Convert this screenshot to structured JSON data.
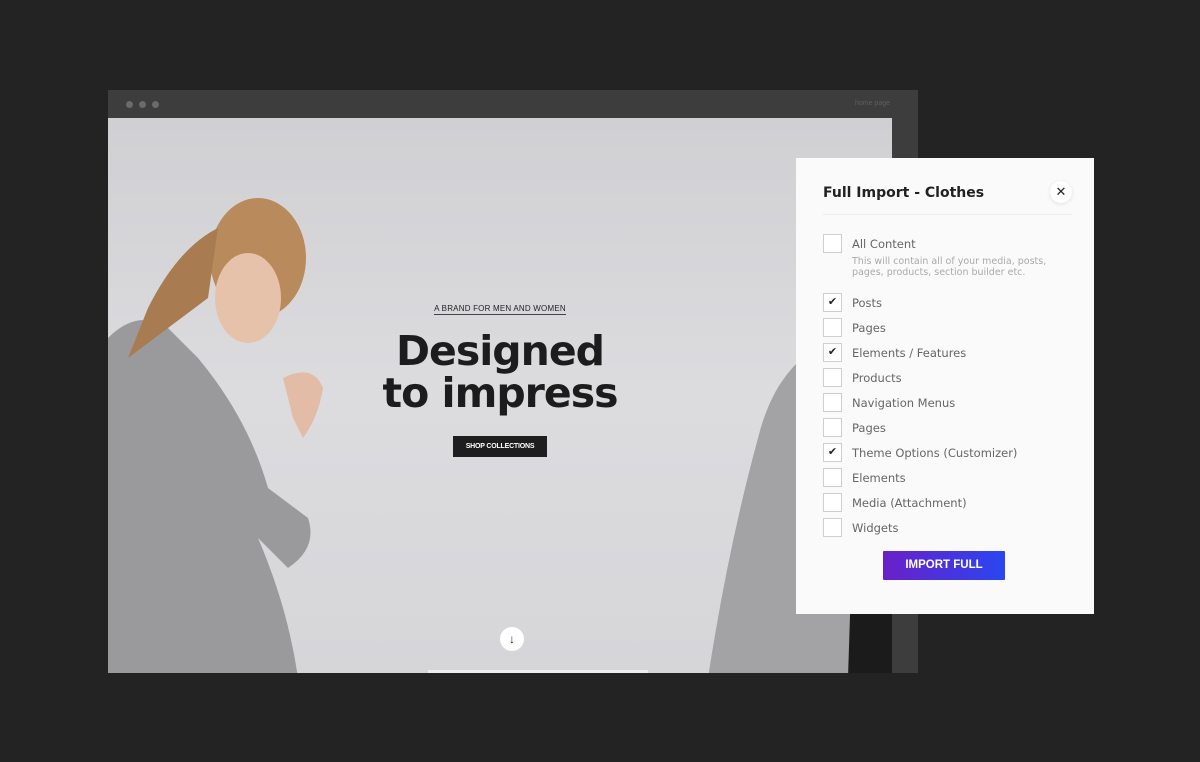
{
  "browser": {
    "url_label": "home page"
  },
  "site": {
    "tagline": "A BRAND FOR MEN AND WOMEN",
    "headline_1": "Designed",
    "headline_2": "to impress",
    "cta": "SHOP COLLECTIONS",
    "scroll_icon": "arrow-down-icon"
  },
  "dialog": {
    "title": "Full Import - Clothes",
    "close_icon": "close-icon",
    "all_content": {
      "label": "All Content",
      "description": "This will contain all of your media, posts, pages, products, section builder etc.",
      "checked": false
    },
    "options": [
      {
        "label": "Posts",
        "checked": true
      },
      {
        "label": "Pages",
        "checked": false
      },
      {
        "label": "Elements / Features",
        "checked": true
      },
      {
        "label": "Products",
        "checked": false
      },
      {
        "label": "Navigation Menus",
        "checked": false
      },
      {
        "label": "Pages",
        "checked": false
      },
      {
        "label": "Theme Options (Customizer)",
        "checked": true
      },
      {
        "label": "Elements",
        "checked": false
      },
      {
        "label": "Media (Attachment)",
        "checked": false
      },
      {
        "label": "Widgets",
        "checked": false
      }
    ],
    "import_button": "IMPORT FULL"
  },
  "colors": {
    "button_start": "#6a20c8",
    "button_end": "#2a46f0",
    "background": "#232323"
  }
}
